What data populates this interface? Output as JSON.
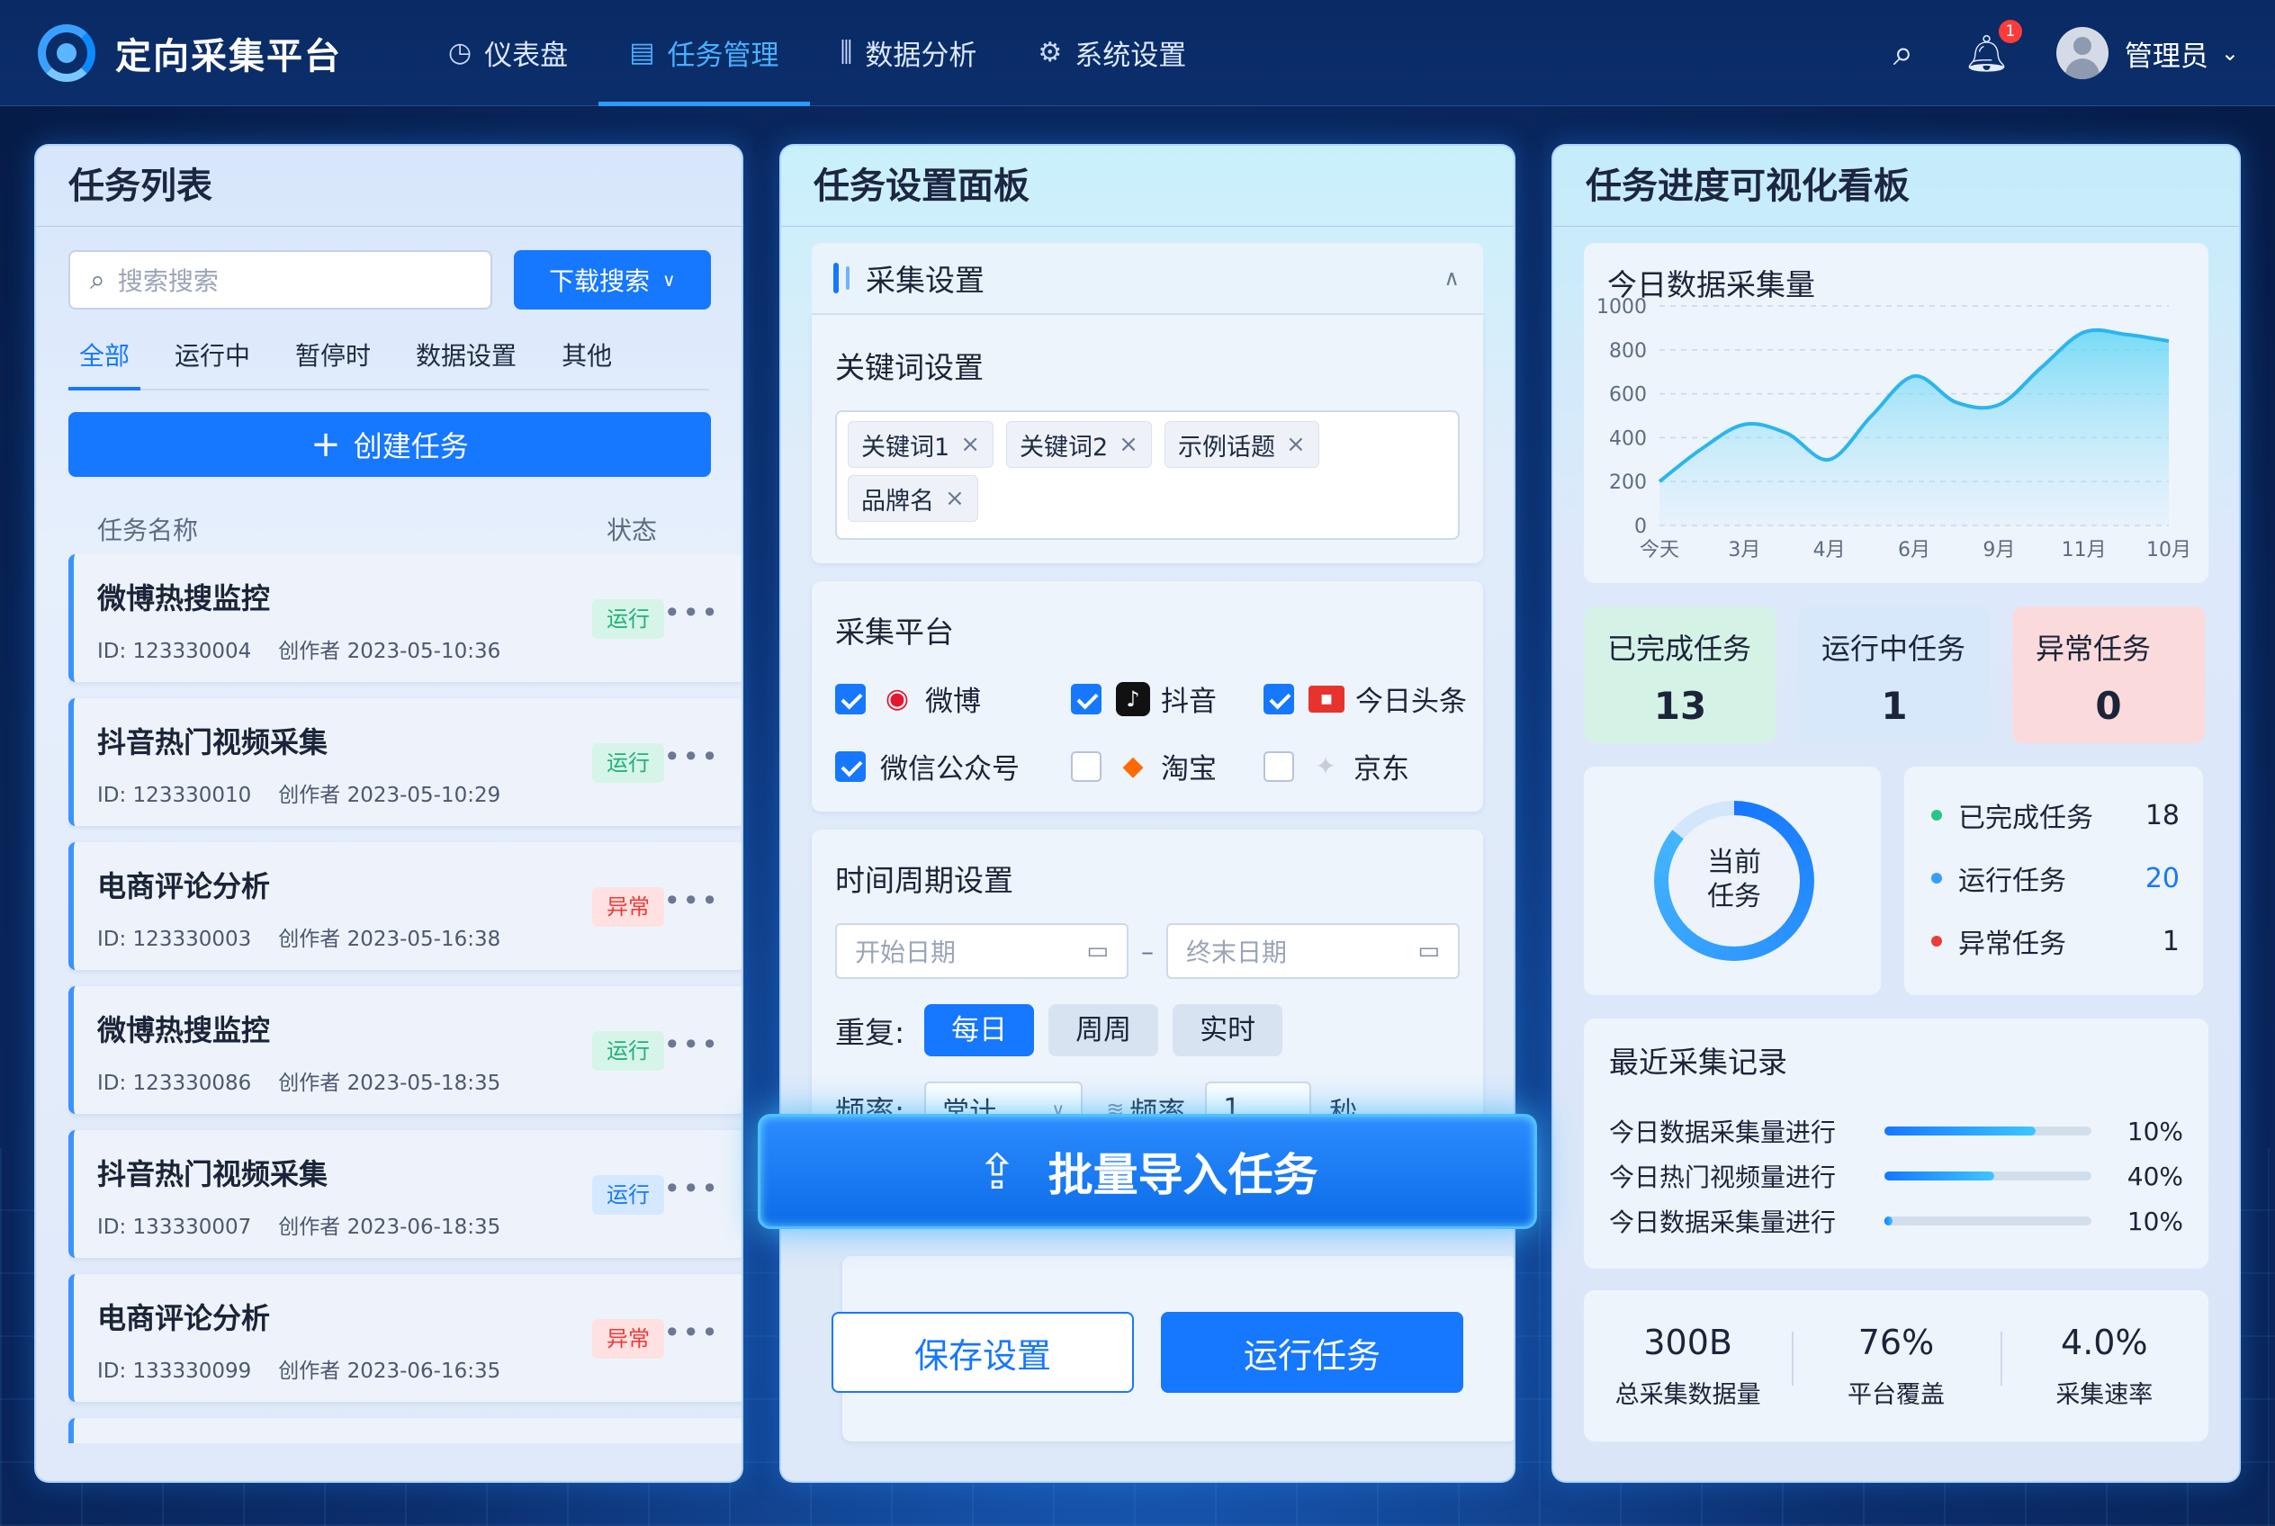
{
  "app": {
    "title": "定向采集平台"
  },
  "nav": [
    {
      "icon": "dashboard-icon",
      "glyph": "◷",
      "label": "仪表盘"
    },
    {
      "icon": "task-icon",
      "glyph": "▤",
      "label": "任务管理",
      "active": true
    },
    {
      "icon": "bar-chart-icon",
      "glyph": "⫼",
      "label": "数据分析"
    },
    {
      "icon": "gear-icon",
      "glyph": "⚙",
      "label": "系统设置"
    }
  ],
  "header": {
    "notification_count": "1",
    "user_name": "管理员"
  },
  "task_list": {
    "title": "任务列表",
    "search_placeholder": "搜索搜索",
    "search_button": "下载搜索",
    "tabs": [
      "全部",
      "运行中",
      "暂停时",
      "数据设置",
      "其他"
    ],
    "create_button": "创建任务",
    "col_name": "任务名称",
    "col_status": "状态",
    "items": [
      {
        "name": "微博热搜监控",
        "id": "ID: 123330004",
        "creator": "创作者 2023-05-10:36",
        "status": "运行",
        "status_type": "run"
      },
      {
        "name": "抖音热门视频采集",
        "id": "ID: 123330010",
        "creator": "创作者 2023-05-10:29",
        "status": "运行",
        "status_type": "run"
      },
      {
        "name": "电商评论分析",
        "id": "ID: 123330003",
        "creator": "创作者 2023-05-16:38",
        "status": "异常",
        "status_type": "err"
      },
      {
        "name": "微博热搜监控",
        "id": "ID: 123330086",
        "creator": "创作者 2023-05-18:35",
        "status": "运行",
        "status_type": "run"
      },
      {
        "name": "抖音热门视频采集",
        "id": "ID: 133330007",
        "creator": "创作者 2023-06-18:35",
        "status": "运行",
        "status_type": "run2"
      },
      {
        "name": "电商评论分析",
        "id": "ID: 133330099",
        "creator": "创作者 2023-06-16:35",
        "status": "异常",
        "status_type": "err"
      }
    ]
  },
  "settings": {
    "title": "任务设置面板",
    "collect_section": "采集设置",
    "keyword_label": "关键词设置",
    "keywords": [
      "关键词1",
      "关键词2",
      "示例话题",
      "品牌名"
    ],
    "platform_label": "采集平台",
    "platforms": [
      {
        "name": "微博",
        "checked": true,
        "icon": "weibo-icon"
      },
      {
        "name": "抖音",
        "checked": true,
        "icon": "douyin-icon"
      },
      {
        "name": "今日头条",
        "checked": true,
        "icon": "toutiao-icon"
      },
      {
        "name": "微信公众号",
        "checked": true,
        "icon": ""
      },
      {
        "name": "淘宝",
        "checked": false,
        "icon": "taobao-icon"
      },
      {
        "name": "京东",
        "checked": false,
        "icon": "jd-icon"
      }
    ],
    "time_label": "时间周期设置",
    "start_placeholder": "开始日期",
    "end_placeholder": "终末日期",
    "repeat_label": "重复:",
    "repeat_options": [
      "每日",
      "周周",
      "实时"
    ],
    "repeat_selected": "每日",
    "freq_label": "频率:",
    "freq_select": "常计",
    "freq_label2": "频率",
    "freq_value": "1",
    "freq_unit": "秒",
    "bulk_import": "批量导入任务",
    "save_button": "保存设置",
    "run_button": "运行任务"
  },
  "dashboard": {
    "title": "任务进度可视化看板",
    "chart_title": "今日数据采集量",
    "stats": [
      {
        "label": "已完成任务",
        "value": "13",
        "tone": "green"
      },
      {
        "label": "运行中任务",
        "value": "1",
        "tone": "blue"
      },
      {
        "label": "异常任务",
        "value": "0",
        "tone": "red"
      }
    ],
    "donut_label_line1": "当前",
    "donut_label_line2": "任务",
    "donut_fraction": 0.86,
    "legend": [
      {
        "label": "已完成任务",
        "value": "18",
        "color": "#2bc48a"
      },
      {
        "label": "运行任务",
        "value": "20",
        "color": "#3a9bff",
        "value_color": "#1677ff"
      },
      {
        "label": "异常任务",
        "value": "1",
        "color": "#ef3a3a"
      }
    ],
    "records_title": "最近采集记录",
    "records": [
      {
        "label": "今日数据采集量进行",
        "pct": "10%",
        "fill": 0.73
      },
      {
        "label": "今日热门视频量进行",
        "pct": "40%",
        "fill": 0.53
      },
      {
        "label": "今日数据采集量进行",
        "pct": "10%",
        "fill": 0.04
      }
    ],
    "summary": [
      {
        "value": "300B",
        "label": "总采集数据量"
      },
      {
        "value": "76%",
        "label": "平台覆盖"
      },
      {
        "value": "4.0%",
        "label": "采集速率"
      }
    ]
  },
  "chart_data": {
    "type": "area",
    "title": "今日数据采集量",
    "x": [
      "今天",
      "3月",
      "4月",
      "6月",
      "9月",
      "11月",
      "10月"
    ],
    "y_ticks": [
      0,
      200,
      400,
      600,
      800,
      1000
    ],
    "ylim": [
      0,
      1000
    ],
    "series": [
      {
        "points": [
          [
            0,
            200
          ],
          [
            0.5,
            350
          ],
          [
            1,
            460
          ],
          [
            1.5,
            420
          ],
          [
            2,
            300
          ],
          [
            2.5,
            500
          ],
          [
            3,
            680
          ],
          [
            3.5,
            560
          ],
          [
            4,
            550
          ],
          [
            4.5,
            720
          ],
          [
            5,
            880
          ],
          [
            5.5,
            870
          ],
          [
            6,
            840
          ]
        ]
      }
    ],
    "grid": true,
    "color": "#2bb5ee"
  }
}
